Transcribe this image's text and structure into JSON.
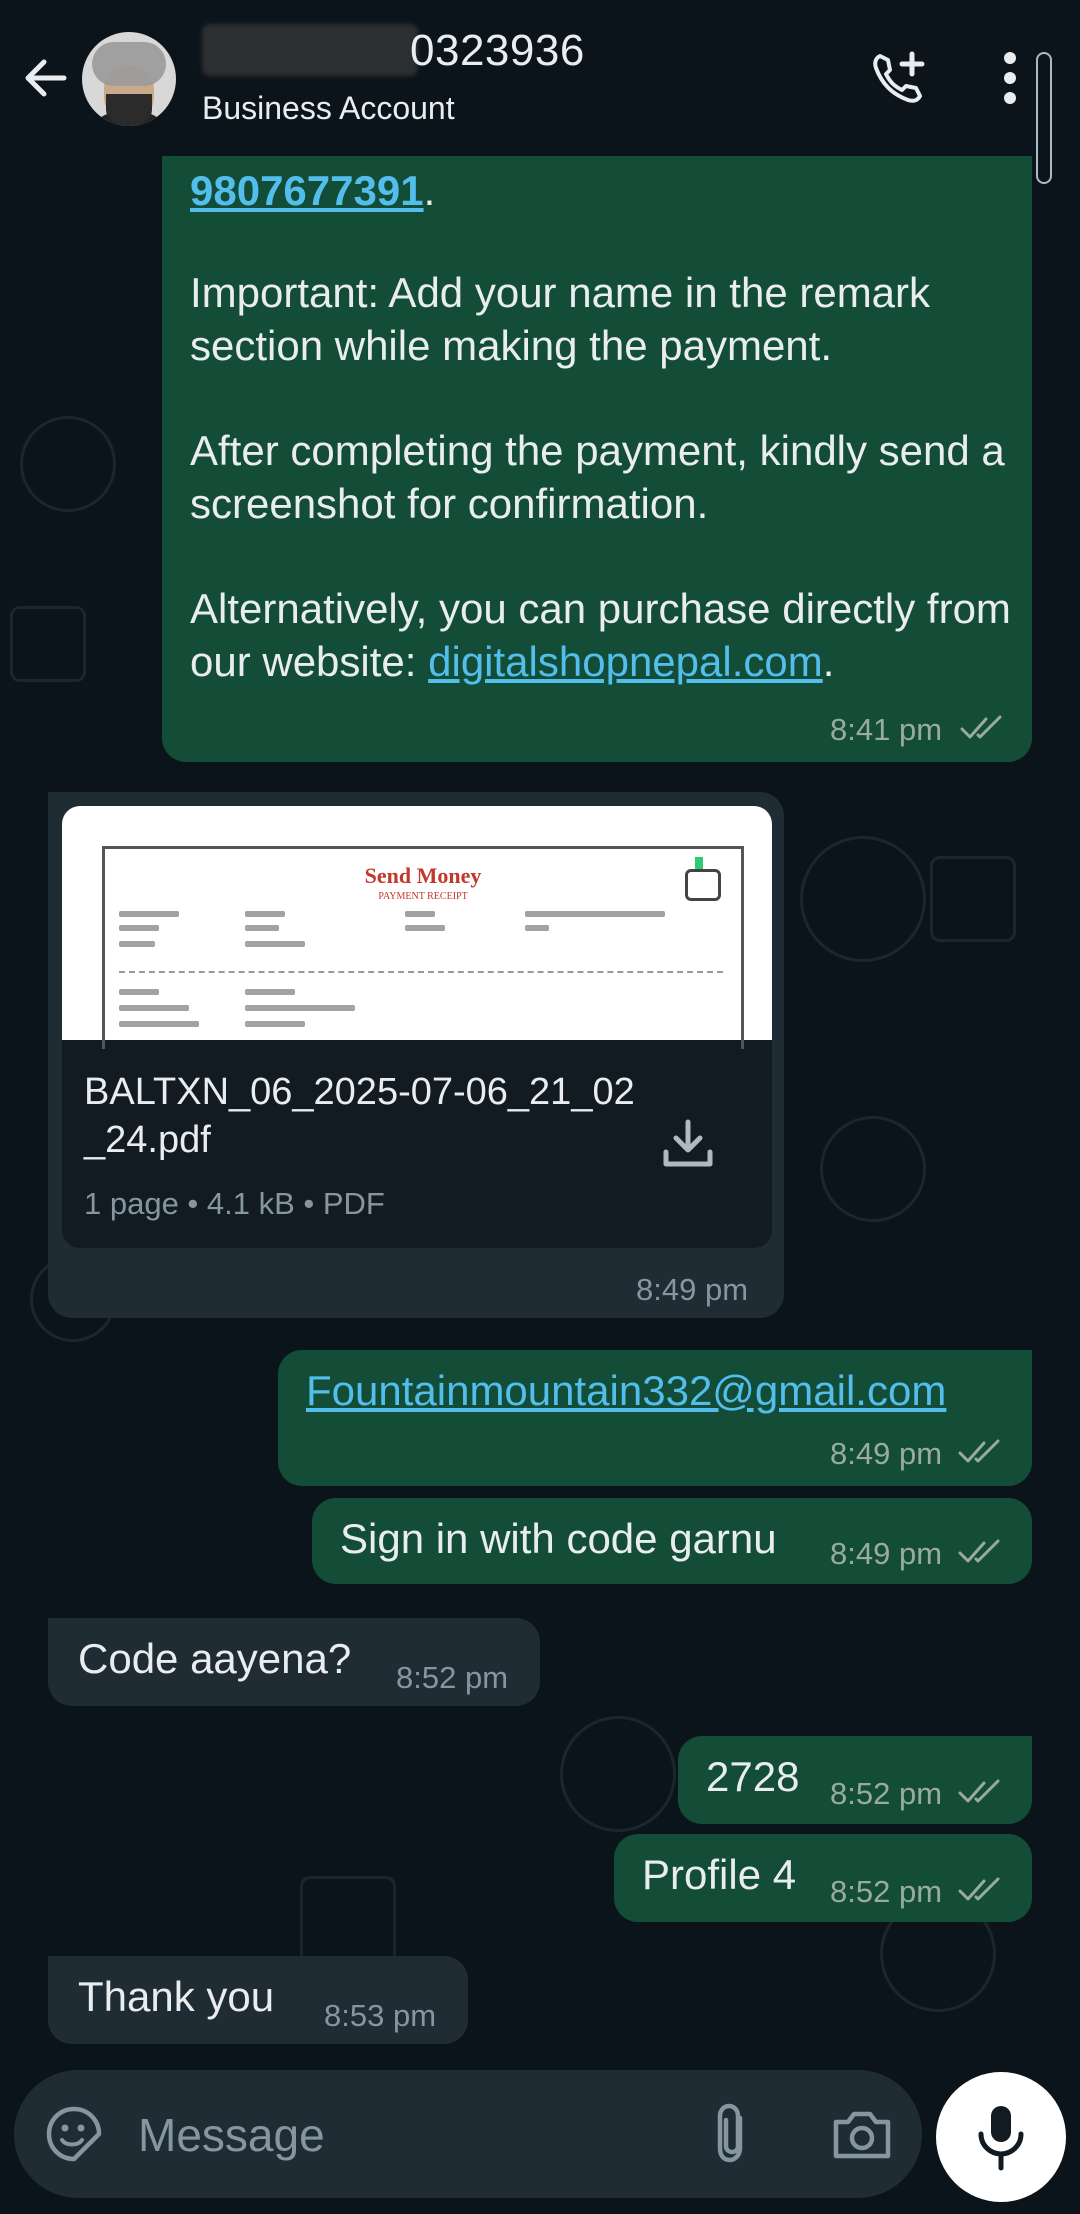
{
  "header": {
    "title": "0323936",
    "subtitle": "Business Account",
    "icons": [
      "back-arrow-icon",
      "avatar",
      "add-call-icon",
      "more-options-icon"
    ]
  },
  "messages": [
    {
      "id": "m1",
      "direction": "outgoing",
      "link_phone": "9807677391",
      "phone_suffix": ".",
      "para1": "Important: Add your name in the remark section while making the payment.",
      "para2": "After completing the payment, kindly send a screenshot for confirmation.",
      "para3_prefix": "Alternatively, you can purchase directly from our website: ",
      "para3_link": "digitalshopnepal.com",
      "para3_suffix": ".",
      "time": "8:41 pm",
      "status": "read"
    },
    {
      "id": "m2",
      "direction": "incoming",
      "type": "document",
      "preview": {
        "heading": "Send Money",
        "subheading": "PAYMENT RECEIPT"
      },
      "filename": "BALTXN_06_2025-07-06_21_02_24.pdf",
      "meta": "1 page • 4.1 kB • PDF",
      "time": "8:49 pm"
    },
    {
      "id": "m3",
      "direction": "outgoing",
      "link": "Fountainmountain332@gmail.com",
      "time": "8:49 pm",
      "status": "read"
    },
    {
      "id": "m4",
      "direction": "outgoing",
      "text": "Sign in with code garnu",
      "time": "8:49 pm",
      "status": "read"
    },
    {
      "id": "m5",
      "direction": "incoming",
      "text": "Code aayena?",
      "time": "8:52 pm"
    },
    {
      "id": "m6",
      "direction": "outgoing",
      "text": "2728",
      "time": "8:52 pm",
      "status": "read"
    },
    {
      "id": "m7",
      "direction": "outgoing",
      "text": "Profile 4",
      "time": "8:52 pm",
      "status": "read"
    },
    {
      "id": "m8",
      "direction": "incoming",
      "text": "Thank you",
      "time": "8:53 pm"
    }
  ],
  "composer": {
    "placeholder": "Message",
    "icons": [
      "emoji-sticker-icon",
      "paperclip-icon",
      "camera-icon",
      "microphone-icon"
    ]
  },
  "colors": {
    "background": "#0b141a",
    "outgoing_bubble": "#144d37",
    "incoming_bubble": "#202c33",
    "link": "#53bdeb",
    "read_ticks": "#99ab9f"
  }
}
